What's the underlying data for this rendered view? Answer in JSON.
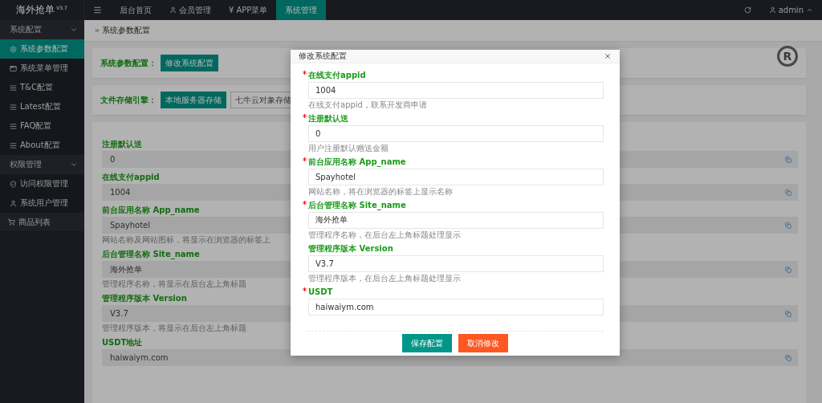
{
  "brand": {
    "name": "海外抢单",
    "version": "V3.7"
  },
  "top_nav": [
    {
      "label": "后台首页",
      "selected": false
    },
    {
      "label": "会员管理",
      "selected": false
    },
    {
      "label": "APP菜单",
      "prefix": "¥",
      "selected": false
    },
    {
      "label": "系统管理",
      "selected": true
    }
  ],
  "user": "admin",
  "sidebar": [
    {
      "kind": "group",
      "label": "系统配置",
      "expanded": true,
      "children": [
        {
          "label": "系统参数配置",
          "selected": true
        },
        {
          "label": "系统菜单管理",
          "selected": false
        },
        {
          "label": "T&C配置",
          "selected": false
        },
        {
          "label": "Latest配置",
          "selected": false
        },
        {
          "label": "FAQ配置",
          "selected": false
        },
        {
          "label": "About配置",
          "selected": false
        }
      ]
    },
    {
      "kind": "group",
      "label": "权限管理",
      "expanded": true,
      "children": [
        {
          "label": "访问权限管理",
          "selected": false
        },
        {
          "label": "系统用户管理",
          "selected": false
        }
      ]
    },
    {
      "kind": "item",
      "label": "商品列表",
      "selected": false
    }
  ],
  "breadcrumb": "系统参数配置",
  "logo_mark": "R",
  "config_card": {
    "label": "系统参数配置：",
    "button": "修改系统配置"
  },
  "storage_card": {
    "label": "文件存储引擎：",
    "options": [
      {
        "label": "本地服务器存储",
        "selected": true
      },
      {
        "label": "七牛云对象存储",
        "selected": false
      }
    ]
  },
  "fields": [
    {
      "label": "注册默认送",
      "value": "0"
    },
    {
      "label": "在线支付appid",
      "value": "1004"
    },
    {
      "label": "前台应用名称 App_name",
      "value": "Spayhotel",
      "help": "网站名称及网站图标，将显示在浏览器的标签上"
    },
    {
      "label": "后台管理名称 Site_name",
      "value": "海外抢单",
      "help": "管理程序名称，将显示在后台左上角标题"
    },
    {
      "label": "管理程序版本 Version",
      "value": "V3.7",
      "help": "管理程序版本，将显示在后台左上角标题"
    },
    {
      "label": "USDT地址",
      "value": "haiwaiym.com"
    }
  ],
  "modal": {
    "title": "修改系统配置",
    "fields": [
      {
        "label": "在线支付appid",
        "required": true,
        "value": "1004",
        "help": "在线支付appid，联系开发商申请"
      },
      {
        "label": "注册默认送",
        "required": true,
        "value": "0",
        "help": "用户注册默认赠送金额"
      },
      {
        "label": "前台应用名称 App_name",
        "required": true,
        "value": "Spayhotel",
        "help": "网站名称，将在浏览器的标签上显示名称"
      },
      {
        "label": "后台管理名称 Site_name",
        "required": true,
        "value": "海外抢单",
        "help": "管理程序名称，在后台左上角标题处理显示"
      },
      {
        "label": "管理程序版本 Version",
        "required": false,
        "value": "V3.7",
        "help": "管理程序版本，在后台左上角标题处理显示"
      },
      {
        "label": "USDT",
        "required": true,
        "value": "haiwaiym.com"
      }
    ],
    "buttons": [
      {
        "label": "保存配置",
        "kind": "primary"
      },
      {
        "label": "取消修改",
        "kind": "danger"
      }
    ]
  }
}
